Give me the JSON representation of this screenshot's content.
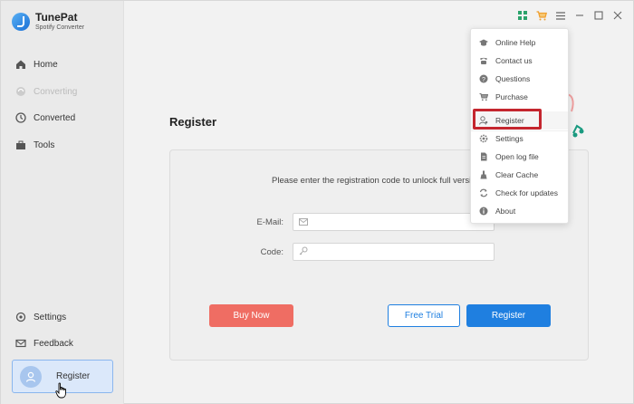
{
  "brand": {
    "name": "TunePat",
    "subtitle": "Spotify Converter"
  },
  "sidebar": {
    "items": [
      {
        "label": "Home",
        "icon": "home-icon"
      },
      {
        "label": "Converting",
        "icon": "sync-icon",
        "disabled": true
      },
      {
        "label": "Converted",
        "icon": "clock-icon"
      },
      {
        "label": "Tools",
        "icon": "toolbox-icon"
      }
    ],
    "bottom": [
      {
        "label": "Settings",
        "icon": "gear-icon"
      },
      {
        "label": "Feedback",
        "icon": "mail-icon"
      }
    ],
    "register_label": "Register"
  },
  "main": {
    "title": "Register",
    "message": "Please enter the registration code to unlock full version.",
    "email_label": "E-Mail:",
    "code_label": "Code:",
    "email_value": "",
    "code_value": "",
    "buy_label": "Buy Now",
    "trial_label": "Free Trial",
    "register_label": "Register"
  },
  "menu": {
    "items": [
      {
        "label": "Online Help",
        "icon": "graduation-cap-icon"
      },
      {
        "label": "Contact us",
        "icon": "phone-icon"
      },
      {
        "label": "Questions",
        "icon": "question-icon"
      },
      {
        "label": "Purchase",
        "icon": "cart-icon"
      },
      {
        "label": "Register",
        "icon": "user-key-icon"
      },
      {
        "label": "Settings",
        "icon": "gear-icon"
      },
      {
        "label": "Open log file",
        "icon": "file-icon"
      },
      {
        "label": "Clear Cache",
        "icon": "broom-icon"
      },
      {
        "label": "Check for updates",
        "icon": "refresh-icon"
      },
      {
        "label": "About",
        "icon": "info-icon"
      }
    ]
  },
  "colors": {
    "accent": "#1f7fe0",
    "buy": "#ef6d63",
    "highlight_box": "#c4262e",
    "sidebar_selected": "#dbe8fa"
  }
}
